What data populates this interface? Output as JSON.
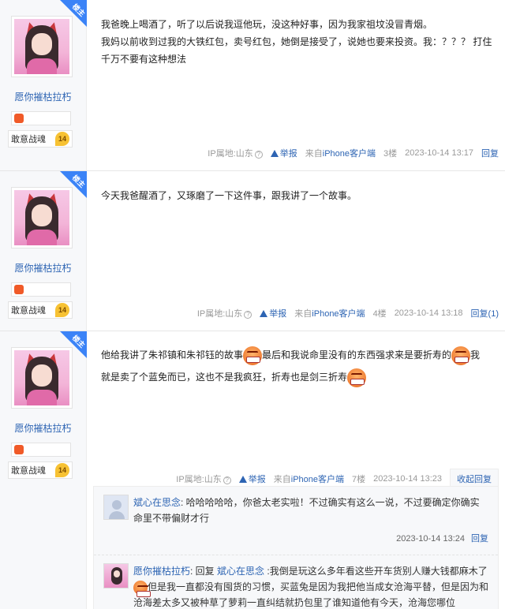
{
  "lz_label": "楼主",
  "posts": [
    {
      "user": "愿你摧枯拉朽",
      "level_name": "敢意战魂",
      "level_num": "14",
      "lines": [
        "我爸晚上喝酒了，听了以后说我逗他玩，没这种好事，因为我家祖坟没冒青烟。",
        "我妈以前收到过我的大铁红包，卖号红包，她倒是接受了，说她也要来投资。我：？？？ 打住千万不要有这种想法"
      ],
      "footer": {
        "ip": "IP属地:山东",
        "report": "举报",
        "src_prefix": "来自",
        "src": "iPhone客户端",
        "floor": "3楼",
        "time": "2023-10-14 13:17",
        "reply": "回复"
      }
    },
    {
      "user": "愿你摧枯拉朽",
      "level_name": "敢意战魂",
      "level_num": "14",
      "lines": [
        "今天我爸醒酒了，又琢磨了一下这件事，跟我讲了一个故事。"
      ],
      "footer": {
        "ip": "IP属地:山东",
        "report": "举报",
        "src_prefix": "来自",
        "src": "iPhone客户端",
        "floor": "4楼",
        "time": "2023-10-14 13:18",
        "reply": "回复(1)"
      }
    },
    {
      "user": "愿你摧枯拉朽",
      "level_name": "敢意战魂",
      "level_num": "14",
      "text_a": "他给我讲了朱祁镇和朱祁钰的故事",
      "text_b": "最后和我说命里没有的东西强求来是要折寿的",
      "text_c": "我",
      "text_d": "就是卖了个蓝免而已，这也不是我疯狂，折寿也是剑三折寿",
      "footer": {
        "ip": "IP属地:山东",
        "report": "举报",
        "src_prefix": "来自",
        "src": "iPhone客户端",
        "floor": "7楼",
        "time": "2023-10-14 13:23",
        "reply": "收起回复"
      }
    }
  ],
  "replies": [
    {
      "name": "斌心在思念",
      "text": ": 哈哈哈哈哈，你爸太老实啦！不过确实有这么一说，不过要确定你确实命里不带偏财才行",
      "time": "2023-10-14 13:24",
      "reply": "回复"
    },
    {
      "name": "愿你摧枯拉朽",
      "reply_word": ": 回复",
      "target": "斌心在思念",
      "text_a": " :我倒是玩这么多年看这些开车货别人赚大钱都麻木了",
      "text_b": "但是我一直都没有囤货的习惯，买蓝兔是因为我把他当成女沧海平替，但是因为和沧海差太多又被种草了萝莉一直纠结就扔包里了谁知道他有今天，沧海您哪位"
    }
  ]
}
